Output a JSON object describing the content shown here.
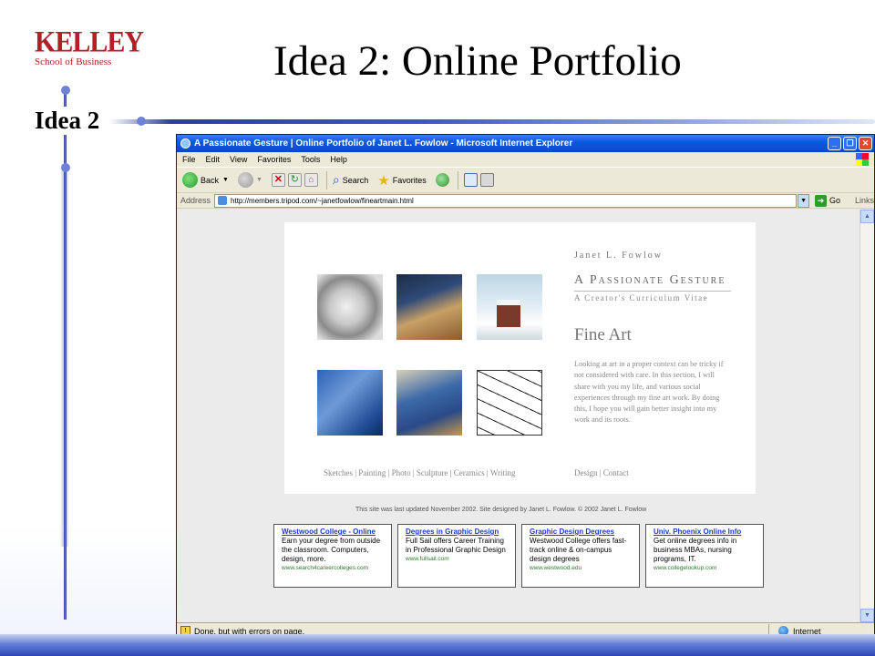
{
  "slide": {
    "logo_main": "KELLEY",
    "logo_sub": "School of Business",
    "title": "Idea 2: Online Portfolio",
    "section_label": "Idea 2"
  },
  "browser": {
    "title": "A Passionate Gesture | Online Portfolio of Janet L. Fowlow - Microsoft Internet Explorer",
    "menu": [
      "File",
      "Edit",
      "View",
      "Favorites",
      "Tools",
      "Help"
    ],
    "toolbar": {
      "back": "Back",
      "search": "Search",
      "favorites": "Favorites"
    },
    "address_label": "Address",
    "address_value": "http://members.tripod.com/~janetfowlow/fineartmain.html",
    "go_label": "Go",
    "links_label": "Links",
    "status_text": "Done, but with errors on page.",
    "status_zone": "Internet"
  },
  "portfolio": {
    "name": "Janet L. Fowlow",
    "heading": "A Passionate Gesture",
    "subheading": "A Creator's Curriculum Vitae",
    "section": "Fine Art",
    "body": "Looking at art in a proper context can be tricky if not considered with care. In this section, I will share with you my life, and various social experiences through my fine art work. By doing this, I hope you will gain better insight into my work and its roots.",
    "nav_left": "Sketches | Painting | Photo | Sculpture | Ceramics | Writing",
    "nav_right": "Design  |  Contact",
    "footer": "This site was last updated November 2002. Site designed by Janet L. Fowlow. © 2002 Janet L. Fowlow"
  },
  "ads": [
    {
      "title": "Westwood College - Online",
      "text": "Earn your degree from outside the classroom. Computers, design, more.",
      "url": "www.search4careercolleges.com"
    },
    {
      "title": "Degrees in Graphic Design",
      "text": "Full Sail offers Career Training in Professional Graphic Design",
      "url": "www.fullsail.com"
    },
    {
      "title": "Graphic Design Degrees",
      "text": "Westwood College offers fast-track online & on-campus design degrees",
      "url": "www.westwood.edu"
    },
    {
      "title": "Univ. Phoenix Online Info",
      "text": "Get online degrees info in business MBAs, nursing programs, IT.",
      "url": "www.collegelookup.com"
    }
  ]
}
